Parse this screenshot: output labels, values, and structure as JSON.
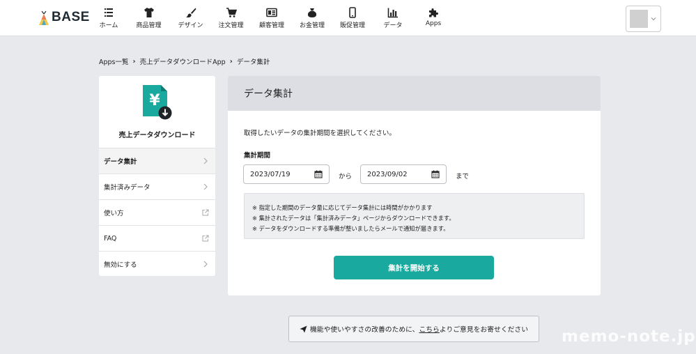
{
  "brand": {
    "name": "BASE"
  },
  "nav": [
    {
      "label": "ホーム",
      "icon": "home-list-icon"
    },
    {
      "label": "商品管理",
      "icon": "tshirt-icon"
    },
    {
      "label": "デザイン",
      "icon": "brush-icon"
    },
    {
      "label": "注文管理",
      "icon": "cart-icon"
    },
    {
      "label": "顧客管理",
      "icon": "customer-card-icon"
    },
    {
      "label": "お金管理",
      "icon": "money-bag-icon"
    },
    {
      "label": "販促管理",
      "icon": "smartphone-icon"
    },
    {
      "label": "データ",
      "icon": "bar-chart-icon"
    },
    {
      "label": "Apps",
      "icon": "puzzle-icon"
    }
  ],
  "breadcrumb": [
    "Apps一覧",
    "売上データダウンロードApp",
    "データ集計"
  ],
  "sidebar": {
    "app_name": "売上データダウンロード",
    "items": [
      {
        "label": "データ集計",
        "active": true,
        "type": "arrow"
      },
      {
        "label": "集計済みデータ",
        "active": false,
        "type": "arrow"
      },
      {
        "label": "使い方",
        "active": false,
        "type": "external"
      },
      {
        "label": "FAQ",
        "active": false,
        "type": "external"
      },
      {
        "label": "無効にする",
        "active": false,
        "type": "arrow"
      }
    ]
  },
  "panel": {
    "title": "データ集計",
    "intro": "取得したいデータの集計期間を選択してください。",
    "period_label": "集計期間",
    "start_date": "2023/07/19",
    "end_date": "2023/09/02",
    "from_text": "から",
    "to_text": "まで",
    "notes": [
      "※ 指定した期間のデータ量に応じてデータ集計には時間がかかります",
      "※ 集計されたデータは「集計済みデータ」ページからダウンロードできます。",
      "※ データをダウンロードする準備が整いましたらメールで通知が届きます。"
    ],
    "start_button": "集計を開始する"
  },
  "feedback": {
    "prefix": "機能や使いやすさの改善のために、",
    "link": "こちら",
    "suffix": "よりご意見をお寄せください"
  },
  "watermark": "memo-note.jp",
  "colors": {
    "accent": "#19a99e",
    "panel_header": "#dcdee3",
    "background": "#e8e9ec"
  }
}
